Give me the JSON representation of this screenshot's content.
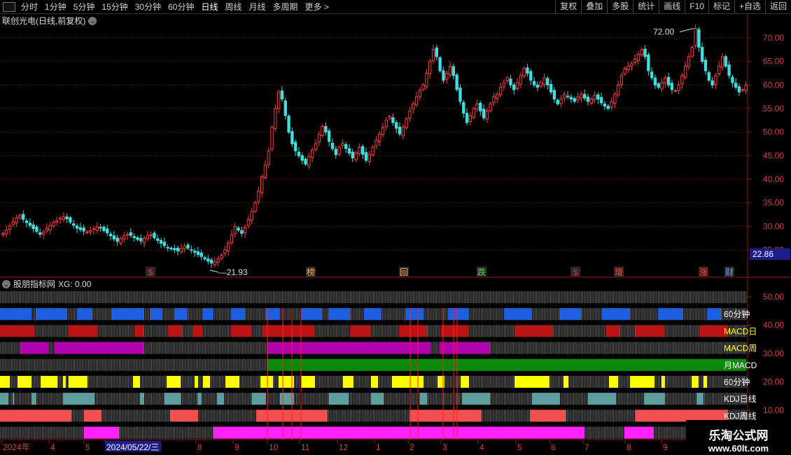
{
  "toolbar": {
    "periods": [
      "分时",
      "1分钟",
      "5分钟",
      "15分钟",
      "30分钟",
      "60分钟",
      "日线",
      "周线",
      "月线",
      "多周期",
      "更多 >"
    ],
    "active_index": 6,
    "right_buttons": [
      "复权",
      "叠加",
      "多股",
      "统计",
      "画线",
      "F10",
      "标记",
      "+自选",
      "返回"
    ]
  },
  "main_chart": {
    "title": "联创光电(日线,前复权)",
    "price_axis": [
      "70.00",
      "65.00",
      "60.00",
      "55.00",
      "50.00",
      "45.00",
      "40.00",
      "35.00",
      "30.00",
      "25.00"
    ],
    "y_max": 72.0,
    "y_max_label": "72.00",
    "y_min_label": "21.93",
    "last_price": "22.86",
    "markers": [
      {
        "text": "$",
        "color": "#e03030"
      },
      {
        "text": "榜",
        "color": "#ffaa55"
      },
      {
        "text": "回",
        "color": "#ffaa55"
      },
      {
        "text": "跌",
        "color": "#44dd44"
      },
      {
        "text": "$",
        "color": "#e03030"
      },
      {
        "text": "增",
        "color": "#ff4040"
      },
      {
        "text": "涨",
        "color": "#ff4040"
      },
      {
        "text": "财",
        "color": "#6aa0ff"
      }
    ],
    "series_close": [
      28.5,
      29.2,
      30.1,
      31.0,
      31.8,
      32.3,
      31.5,
      30.8,
      30.2,
      29.5,
      28.9,
      28.3,
      28.8,
      29.6,
      30.2,
      30.8,
      31.2,
      31.7,
      32.0,
      31.6,
      30.9,
      30.2,
      29.6,
      29.3,
      29.0,
      28.8,
      29.1,
      29.5,
      29.9,
      29.7,
      29.1,
      28.6,
      28.0,
      27.3,
      26.8,
      27.4,
      28.0,
      28.3,
      28.1,
      27.6,
      27.2,
      26.9,
      27.5,
      28.0,
      28.2,
      27.6,
      27.0,
      26.4,
      25.9,
      25.5,
      25.2,
      25.0,
      24.8,
      25.3,
      25.8,
      25.4,
      24.9,
      24.5,
      24.0,
      23.6,
      23.1,
      22.6,
      22.2,
      22.5,
      23.1,
      23.9,
      25.0,
      26.5,
      28.2,
      30.0,
      29.2,
      28.5,
      29.8,
      31.5,
      33.2,
      35.0,
      37.5,
      40.5,
      43.0,
      46.0,
      51.0,
      55.0,
      58.5,
      57.0,
      53.5,
      50.0,
      47.5,
      46.0,
      45.0,
      44.0,
      43.2,
      44.8,
      46.2,
      47.5,
      49.5,
      51.2,
      50.0,
      48.0,
      46.5,
      45.2,
      46.8,
      47.6,
      46.5,
      45.5,
      44.5,
      45.6,
      46.8,
      45.3,
      44.0,
      45.2,
      46.8,
      48.3,
      49.6,
      51.0,
      52.5,
      53.3,
      52.0,
      50.8,
      49.6,
      51.0,
      52.8,
      54.5,
      56.0,
      57.5,
      58.8,
      60.0,
      62.5,
      65.0,
      67.5,
      66.0,
      63.0,
      61.0,
      62.5,
      64.0,
      62.0,
      59.0,
      56.5,
      54.0,
      52.0,
      53.5,
      55.0,
      56.0,
      54.5,
      53.0,
      54.5,
      56.0,
      57.5,
      58.0,
      59.5,
      60.5,
      61.5,
      60.0,
      59.0,
      60.5,
      62.0,
      63.5,
      62.5,
      61.0,
      60.0,
      59.5,
      60.5,
      61.5,
      60.0,
      58.5,
      57.0,
      56.0,
      57.0,
      58.0,
      57.5,
      57.0,
      56.5,
      57.5,
      58.0,
      57.2,
      56.5,
      57.0,
      57.8,
      57.0,
      56.2,
      55.5,
      55.0,
      56.5,
      58.0,
      60.0,
      62.0,
      63.5,
      64.0,
      64.5,
      65.5,
      66.5,
      67.5,
      66.0,
      63.0,
      61.5,
      60.0,
      59.5,
      60.5,
      61.5,
      60.0,
      59.0,
      58.8,
      60.0,
      62.0,
      64.0,
      66.0,
      68.0,
      72.0,
      68.0,
      65.0,
      63.0,
      61.0,
      60.0,
      62.0,
      64.0,
      66.0,
      64.0,
      62.0,
      60.5,
      59.5,
      58.5,
      59.0,
      60.0
    ],
    "close_ratio": 0.62
  },
  "indicator_panel": {
    "title": "股朋指标网",
    "xg_label": "XG: 0.00",
    "axis": [
      "50.00",
      "40.00",
      "30.00",
      "20.00",
      "10.00"
    ],
    "rows": [
      {
        "label": "",
        "color": "#bbbbbb",
        "mode": "dense"
      },
      {
        "label": "60分钟",
        "color": "#1e5fe0",
        "segments": [
          [
            0,
            45
          ],
          [
            52,
            95
          ],
          [
            110,
            132
          ],
          [
            160,
            205
          ],
          [
            215,
            232
          ],
          [
            250,
            268
          ],
          [
            290,
            305
          ],
          [
            330,
            350
          ],
          [
            380,
            400
          ],
          [
            430,
            460
          ],
          [
            470,
            500
          ],
          [
            520,
            545
          ],
          [
            580,
            605
          ],
          [
            640,
            670
          ],
          [
            720,
            760
          ],
          [
            800,
            830
          ],
          [
            860,
            900
          ],
          [
            940,
            975
          ],
          [
            1010,
            1030
          ]
        ]
      },
      {
        "label": "MACD日",
        "color": "#b81414",
        "segments": [
          [
            0,
            50
          ],
          [
            97,
            140
          ],
          [
            192,
            205
          ],
          [
            240,
            260
          ],
          [
            275,
            290
          ],
          [
            330,
            360
          ],
          [
            375,
            450
          ],
          [
            500,
            530
          ],
          [
            570,
            610
          ],
          [
            630,
            670
          ],
          [
            735,
            790
          ],
          [
            865,
            885
          ],
          [
            908,
            950
          ],
          [
            1000,
            1040
          ]
        ]
      },
      {
        "label": "MACD周",
        "color": "#b000b0",
        "segments": [
          [
            30,
            70
          ],
          [
            78,
            205
          ],
          [
            382,
            615
          ],
          [
            628,
            700
          ]
        ]
      },
      {
        "label": "月MACD",
        "color": "#0a8a0a",
        "segments": [
          [
            382,
            1068
          ]
        ]
      },
      {
        "label": "60分钟",
        "color": "#ffff00",
        "segments": [
          [
            0,
            14
          ],
          [
            25,
            45
          ],
          [
            58,
            82
          ],
          [
            90,
            94
          ],
          [
            98,
            125
          ],
          [
            190,
            200
          ],
          [
            238,
            258
          ],
          [
            278,
            283
          ],
          [
            290,
            300
          ],
          [
            322,
            342
          ],
          [
            372,
            390
          ],
          [
            398,
            420
          ],
          [
            430,
            450
          ],
          [
            490,
            505
          ],
          [
            530,
            540
          ],
          [
            560,
            605
          ],
          [
            625,
            635
          ],
          [
            658,
            670
          ],
          [
            735,
            785
          ],
          [
            805,
            812
          ],
          [
            870,
            883
          ],
          [
            900,
            935
          ],
          [
            945,
            950
          ],
          [
            988,
            998
          ],
          [
            1005,
            1010
          ]
        ]
      },
      {
        "label": "KDJ日线",
        "color": "#5f9e9e",
        "segments": [
          [
            0,
            12
          ],
          [
            18,
            20
          ],
          [
            45,
            52
          ],
          [
            90,
            135
          ],
          [
            200,
            206
          ],
          [
            235,
            258
          ],
          [
            282,
            288
          ],
          [
            310,
            320
          ],
          [
            360,
            380
          ],
          [
            400,
            420
          ],
          [
            470,
            498
          ],
          [
            530,
            548
          ],
          [
            600,
            610
          ],
          [
            660,
            700
          ],
          [
            760,
            800
          ],
          [
            840,
            880
          ],
          [
            920,
            950
          ],
          [
            995,
            1005
          ]
        ]
      },
      {
        "label": "KDJ周线",
        "color": "#f05050",
        "segments": [
          [
            0,
            102
          ],
          [
            120,
            145
          ],
          [
            243,
            283
          ],
          [
            366,
            468
          ],
          [
            585,
            688
          ],
          [
            757,
            808
          ],
          [
            908,
            1040
          ]
        ]
      },
      {
        "label": "",
        "color": "#ff22ff",
        "segments": [
          [
            120,
            170
          ],
          [
            305,
            835
          ],
          [
            892,
            934
          ]
        ]
      }
    ]
  },
  "date_axis": {
    "labels": [
      "2024年",
      "4",
      "5",
      "2024/05/22/三",
      "8",
      "9",
      "10",
      "11",
      "12",
      "1",
      "2",
      "3",
      "4",
      "5",
      "6",
      "7",
      "8",
      "9"
    ],
    "highlight_index": 3
  },
  "watermark": {
    "line1": "乐淘公式网",
    "line2": "www.60lt.com"
  },
  "colors": {
    "grid": "#6a1010",
    "axis": "#d04040",
    "up": "#ff3b3b",
    "down": "#3fdfdf"
  }
}
